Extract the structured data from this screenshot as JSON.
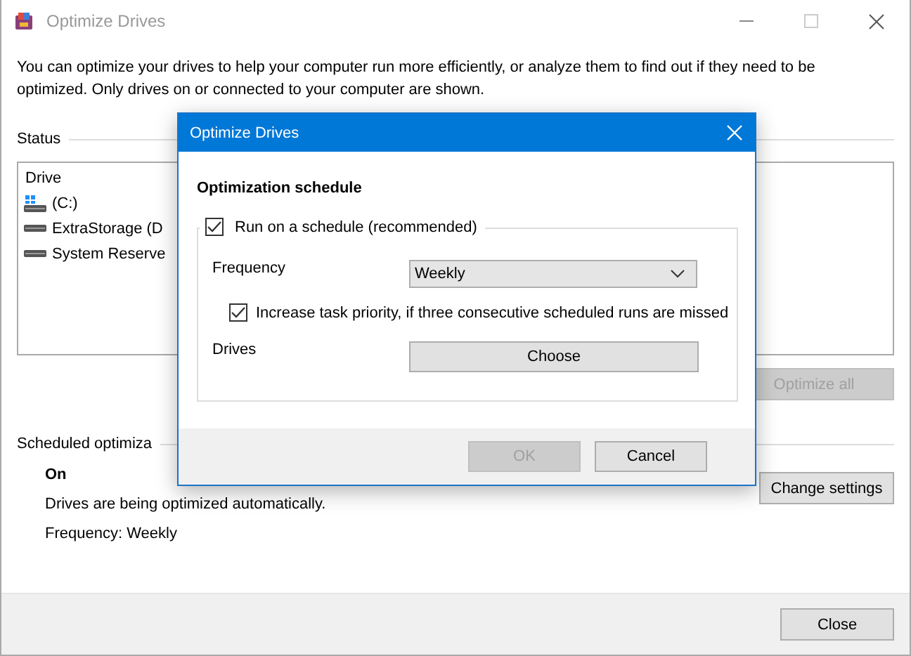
{
  "main_window": {
    "title": "Optimize Drives",
    "maximize_disabled": true,
    "description": "You can optimize your drives to help your computer run more efficiently, or analyze them to find out if they need to be optimized. Only drives on or connected to your computer are shown.",
    "status_label": "Status",
    "drive_list": {
      "column": "Drive",
      "drives": [
        {
          "name": "(C:)",
          "kind": "system"
        },
        {
          "name": "ExtraStorage (D",
          "kind": "disk"
        },
        {
          "name": "System Reserve",
          "kind": "disk"
        }
      ]
    },
    "optimize_all_button": {
      "label": "Optimize all",
      "disabled": true
    },
    "scheduled": {
      "heading": "Scheduled optimiza",
      "state": "On",
      "message": "Drives are being optimized automatically.",
      "frequency": "Frequency: Weekly",
      "button": "Change settings"
    },
    "close_button": "Close"
  },
  "dialog": {
    "title": "Optimize Drives",
    "heading": "Optimization schedule",
    "schedule_checkbox": {
      "label": "Run on a schedule (recommended)",
      "checked": true
    },
    "frequency_label": "Frequency",
    "frequency_select": {
      "value": "Weekly"
    },
    "priority_checkbox": {
      "label": "Increase task priority, if three consecutive scheduled runs are missed",
      "checked": true
    },
    "drives_label": "Drives",
    "choose_button": "Choose",
    "ok_button": {
      "label": "OK",
      "disabled": true
    },
    "cancel_button": {
      "label": "Cancel",
      "disabled": false
    }
  }
}
